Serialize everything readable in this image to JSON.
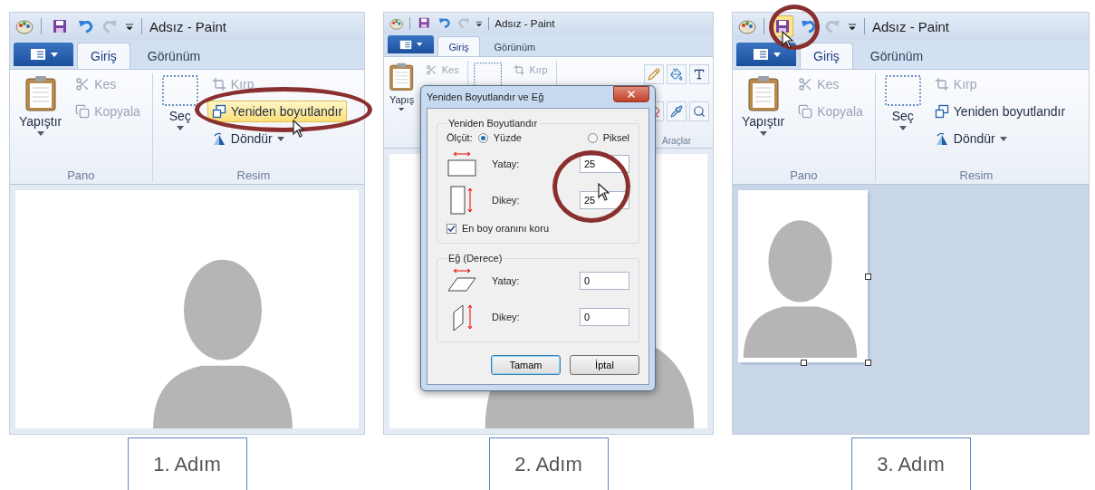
{
  "panels": [
    {
      "kind": "resize",
      "title": "Adsız - Paint",
      "save_hovered": false,
      "tabs": [
        {
          "label": "Giriş",
          "selected": true
        },
        {
          "label": "Görünüm",
          "selected": false
        }
      ],
      "groups": [
        {
          "kind": "clipboard",
          "label": "Pano",
          "big": "Yapıştır",
          "items": [
            {
              "kind": "cut",
              "label": "Kes",
              "disabled": true,
              "highlighted": false
            },
            {
              "kind": "copy",
              "label": "Kopyala",
              "disabled": true,
              "highlighted": false
            }
          ]
        },
        {
          "kind": "image",
          "label": "Resim",
          "big": "Seç",
          "items": [
            {
              "kind": "crop",
              "label": "Kırp",
              "disabled": true,
              "highlighted": false
            },
            {
              "kind": "resize",
              "label": "Yeniden boyutlandır",
              "disabled": false,
              "highlighted": true
            },
            {
              "kind": "rotate",
              "label": "Döndür",
              "disabled": false,
              "highlighted": false
            }
          ]
        }
      ],
      "step": "1. Adım"
    },
    {
      "kind": "dialog",
      "title": "Adsız - Paint",
      "save_hovered": false,
      "tabs": [
        {
          "label": "Giriş",
          "selected": true
        },
        {
          "label": "Görünüm",
          "selected": false
        }
      ],
      "groups": [
        {
          "kind": "clipboard",
          "big": "Yapış",
          "items": [
            {
              "kind": "cut",
              "label": "Kes",
              "disabled": true,
              "highlighted": false
            }
          ]
        },
        {
          "kind": "image",
          "items": [
            {
              "kind": "crop",
              "label": "Kırp",
              "disabled": true,
              "highlighted": false
            }
          ]
        },
        {
          "kind": "tools",
          "label": "Araçlar"
        }
      ],
      "dialog": {
        "title": "Yeniden Boyutlandır ve Eğ",
        "resize": {
          "legend": "Yeniden Boyutlandır",
          "unit_label": "Ölçüt:",
          "units": [
            {
              "label": "Yüzde",
              "selected": true
            },
            {
              "label": "Piksel",
              "selected": false
            }
          ],
          "fields": [
            {
              "kind": "horizontal",
              "label": "Yatay:",
              "value": "25"
            },
            {
              "kind": "vertical",
              "label": "Dikey:",
              "value": "25"
            }
          ],
          "keep_ratio": {
            "label": "En boy oranını koru",
            "checked": true
          }
        },
        "skew": {
          "legend": "Eğ (Derece)",
          "fields": [
            {
              "kind": "horizontal",
              "label": "Yatay:",
              "value": "0"
            },
            {
              "kind": "vertical",
              "label": "Dikey:",
              "value": "0"
            }
          ]
        },
        "buttons": [
          {
            "label": "Tamam",
            "default": true
          },
          {
            "label": "İptal",
            "default": false
          }
        ]
      },
      "step": "2. Adım"
    },
    {
      "kind": "save",
      "title": "Adsız - Paint",
      "save_hovered": true,
      "tabs": [
        {
          "label": "Giriş",
          "selected": true
        },
        {
          "label": "Görünüm",
          "selected": false
        }
      ],
      "groups": [
        {
          "kind": "clipboard",
          "label": "Pano",
          "big": "Yapıştır",
          "items": [
            {
              "kind": "cut",
              "label": "Kes",
              "disabled": true,
              "highlighted": false
            },
            {
              "kind": "copy",
              "label": "Kopyala",
              "disabled": true,
              "highlighted": false
            }
          ]
        },
        {
          "kind": "image",
          "label": "Resim",
          "big": "Seç",
          "items": [
            {
              "kind": "crop",
              "label": "Kırp",
              "disabled": true,
              "highlighted": false
            },
            {
              "kind": "resize",
              "label": "Yeniden boyutlandır",
              "disabled": false,
              "highlighted": false
            },
            {
              "kind": "rotate",
              "label": "Döndür",
              "disabled": false,
              "highlighted": false
            }
          ]
        }
      ],
      "step": "3. Adım"
    }
  ]
}
